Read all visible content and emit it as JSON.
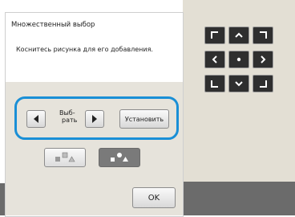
{
  "dialog": {
    "title": "Множественный выбор",
    "message": "Коснитесь рисунка для его добавления."
  },
  "select": {
    "label_line1": "Выб-",
    "label_line2": "рать",
    "set_label": "Установить"
  },
  "ok_label": "OK",
  "colors": {
    "highlight": "#1a8fd6",
    "dir_button": "#2f2f2f",
    "panel_bg": "#e6e3db",
    "right_bg": "#e3dfd4"
  },
  "icons": {
    "prev": "triangle-left-icon",
    "next": "triangle-right-icon",
    "mode1": "shapes-group-icon",
    "mode2": "shapes-ungroup-icon",
    "dir": [
      "corner-up-left-icon",
      "chevron-up-icon",
      "corner-up-right-icon",
      "chevron-left-icon",
      "center-dot-icon",
      "chevron-right-icon",
      "corner-down-left-icon",
      "chevron-down-icon",
      "corner-down-right-icon"
    ]
  }
}
